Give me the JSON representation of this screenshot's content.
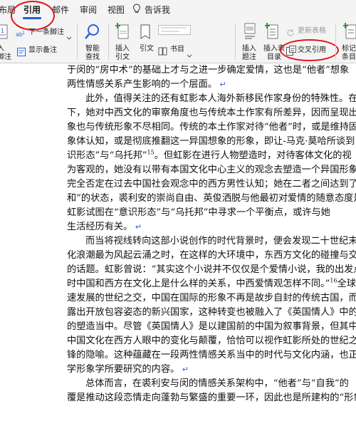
{
  "tabs": {
    "layout_partial": "布局",
    "references": "引用",
    "mailings": "邮件",
    "review": "审阅",
    "view": "视图",
    "tellme": "告诉我"
  },
  "ribbon": {
    "insert_footnote_partial": "入\n脚注",
    "next_footnote": "下一条脚注",
    "show_notes": "显示备注",
    "smart_lookup": "智能\n查找",
    "insert_citation": "插入\n引文",
    "citation": "引文",
    "bibliography": "书目",
    "insert_caption": "插入\n题注",
    "insert_table_of_figures": "插入表\n目录",
    "update_table": "更新表格",
    "cross_reference": "交叉引用",
    "mark_entry_partial": "标记\n条目"
  },
  "document": {
    "lines": [
      {
        "text": "于闵的“房中术”的基础上才与之进一步确定爱情，这也是“他者”想象",
        "indent": false,
        "mark": false
      },
      {
        "text": "两性情感关系产生影响的一个层面。",
        "indent": false,
        "mark": true
      },
      {
        "text": "此外，值得关注的还有虹影本人海外新移民作家身份的特殊性。在这",
        "indent": true,
        "mark": false
      },
      {
        "text": "下，她对中西文化的审察角度也与传统本土作家有所差异，因而呈现出的",
        "indent": false,
        "mark": false
      },
      {
        "text": "象也与传统形象不尽相同。传统的本土作家对待“他者”时，或是维持固",
        "indent": false,
        "mark": false
      },
      {
        "text": "象体认知，或是彻底推翻这一异国想象的形象，即让-马克·莫哈所谈到",
        "indent": false,
        "mark": false
      },
      {
        "text": "识形态”与“乌托邦”",
        "sup": "15",
        "tail": "。但虹影在进行人物塑造时，对待客体文化的视",
        "indent": false,
        "mark": false
      },
      {
        "text": "为客观的，她没有以带有本国文化中心主义的观念去塑造一个异国形象，",
        "indent": false,
        "mark": false
      },
      {
        "text": "完全否定在过去中国社会观念中的西方男性认知；她在二者之间达到了一",
        "indent": false,
        "mark": false
      },
      {
        "text": "和”的状态，裘利安的崇尚自由、英俊洒脱与他最初对爱情的随意态度是并",
        "indent": false,
        "mark": false
      },
      {
        "text": "虹影试图在“意识形态”与“乌托邦”中寻求一个平衡点，或许与她",
        "indent": false,
        "mark": false
      },
      {
        "text": "生活经历有关。",
        "indent": false,
        "mark": true
      },
      {
        "text": "而当将视线转向这部小说创作的时代背景时，便会发现二十世纪末正",
        "indent": true,
        "mark": false
      },
      {
        "text": "化浪潮最为风起云涌之时，在这样的大环境中，东西方文化的碰撞与交流",
        "indent": false,
        "mark": false
      },
      {
        "text": "的话题。虹影曾说：“其实这个小说并不仅仅是个爱情小说，我的出发点",
        "indent": false,
        "mark": false
      },
      {
        "text": "时中国和西方在文化上是什么样的关系，中西爱情观怎样不同。”",
        "sup": "16",
        "tail": "全球化",
        "indent": false,
        "mark": false
      },
      {
        "text": "速发展的世纪之交，中国在国际的形象不再是故步自封的传统古国，而是",
        "indent": false,
        "mark": false
      },
      {
        "text": "露出开放包容姿态的新兴国家，这种转变也被融入了《英国情人》中的人",
        "indent": false,
        "mark": false
      },
      {
        "text": "的塑造当中。尽管《英国情人》是以建国前的中国为叙事背景，但其中所",
        "indent": false,
        "mark": false
      },
      {
        "text": "中国文化在西方人眼中的变化与颠覆，恰恰可以视作虹影所处的世纪之交",
        "indent": false,
        "mark": false
      },
      {
        "text": "锋的隐喻。这种蕴藏在一段两性情感关系当中的时代与文化内涵，也正是",
        "indent": false,
        "mark": false
      },
      {
        "text": "学形象学所要研究的内容。",
        "indent": false,
        "mark": true
      },
      {
        "text": "总体而言，在裘利安与闵的情感关系架构中，“他者”与“自我”的",
        "indent": true,
        "mark": false
      },
      {
        "text": "覆是推动这段恋情走向蓬勃与繁盛的重要一环，因此也是所建构的“形象",
        "indent": false,
        "mark": false
      }
    ]
  }
}
